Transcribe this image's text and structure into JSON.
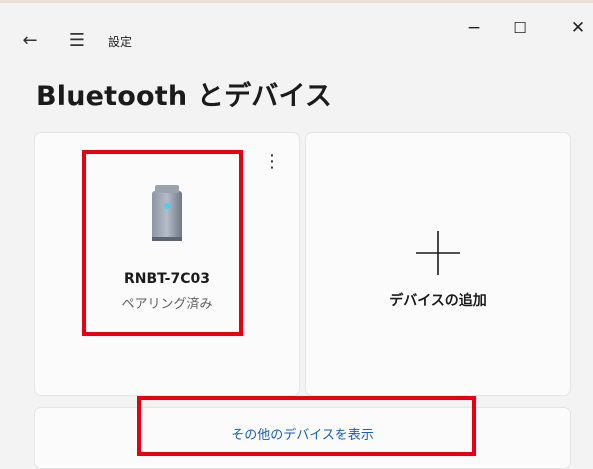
{
  "window": {
    "app_title": "設定",
    "controls": {
      "minimize": "−",
      "maximize": "☐",
      "close": "✕"
    },
    "nav": {
      "back": "←",
      "menu": "☰"
    }
  },
  "page": {
    "title": "Bluetooth とデバイス"
  },
  "devices": [
    {
      "name": "RNBT-7C03",
      "status": "ペアリング済み",
      "more_icon": "⋮"
    }
  ],
  "add_device": {
    "icon": "plus-icon",
    "label": "デバイスの追加"
  },
  "show_more": {
    "label": "その他のデバイスを表示"
  },
  "colors": {
    "highlight": "#e60012",
    "link": "#1a5fb4",
    "background": "#f3f3f3",
    "card": "#fbfbfb"
  }
}
